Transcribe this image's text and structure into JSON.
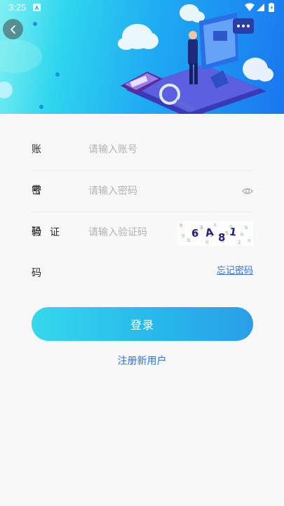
{
  "status_bar": {
    "time": "3:25"
  },
  "header": {
    "back_icon": "chevron-left-icon"
  },
  "form": {
    "account": {
      "label": "账号",
      "placeholder": "请输入账号",
      "value": ""
    },
    "password": {
      "label": "密码",
      "placeholder": "请输入密码",
      "value": "",
      "toggle_icon": "eye-icon"
    },
    "captcha": {
      "label": "验证码",
      "placeholder": "请输入验证码",
      "value": "",
      "code": "6A81"
    }
  },
  "forgot_password": "忘记密码",
  "login_button": "登录",
  "register": "注册新用户",
  "colors": {
    "accent": "#26b6ea",
    "link": "#2f73e0"
  }
}
